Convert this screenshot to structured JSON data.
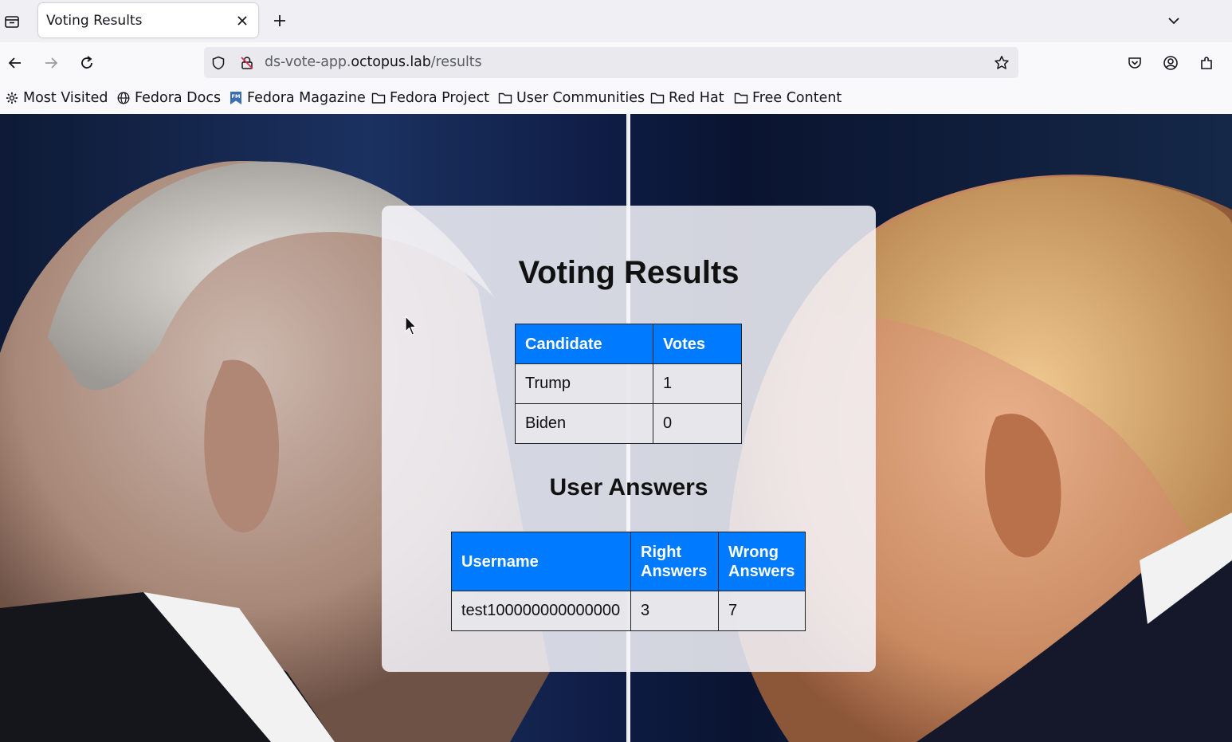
{
  "browser": {
    "tab": {
      "title": "Voting Results",
      "close_glyph": "×"
    },
    "new_tab_glyph": "+",
    "url": {
      "prefix": "ds-vote-app.",
      "host": "octopus.lab",
      "path": "/results"
    },
    "bookmarks": [
      {
        "label": "Most Visited",
        "icon": "gear-icon"
      },
      {
        "label": "Fedora Docs",
        "icon": "globe-icon"
      },
      {
        "label": "Fedora Magazine",
        "icon": "fedora-magazine-icon"
      },
      {
        "label": "Fedora Project",
        "icon": "folder-icon"
      },
      {
        "label": "User Communities",
        "icon": "folder-icon"
      },
      {
        "label": "Red Hat",
        "icon": "folder-icon"
      },
      {
        "label": "Free Content",
        "icon": "folder-icon"
      }
    ]
  },
  "page": {
    "title": "Voting Results",
    "votes_table": {
      "headers": [
        "Candidate",
        "Votes"
      ],
      "rows": [
        [
          "Trump",
          "1"
        ],
        [
          "Biden",
          "0"
        ]
      ]
    },
    "answers_title": "User Answers",
    "answers_table": {
      "headers": [
        "Username",
        "Right Answers",
        "Wrong Answers"
      ],
      "rows": [
        [
          "test100000000000000",
          "3",
          "7"
        ]
      ]
    }
  },
  "colors": {
    "table_header": "#007bff",
    "panel": "#f5f5fa"
  }
}
